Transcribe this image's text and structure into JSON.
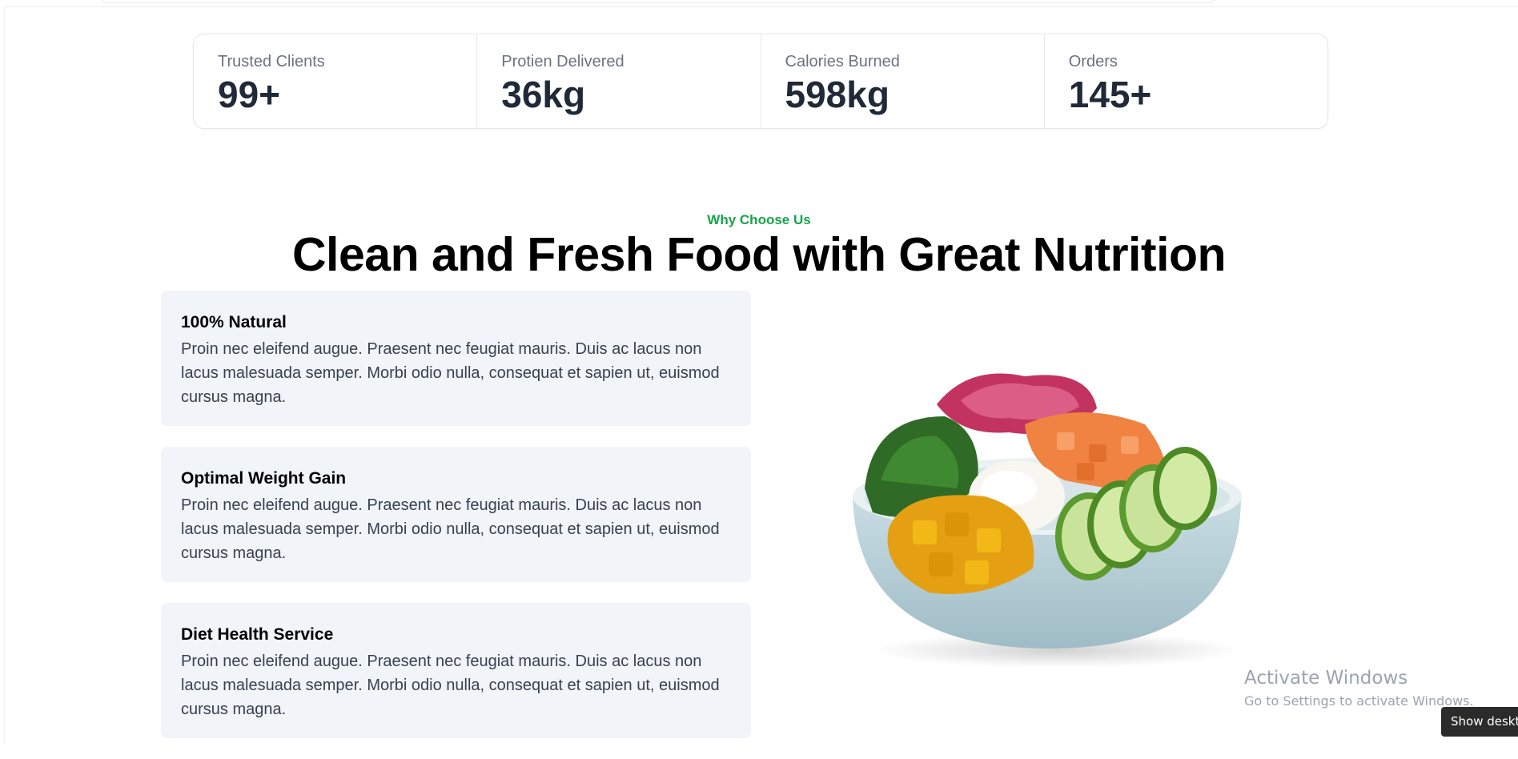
{
  "stats": [
    {
      "label": "Trusted Clients",
      "value": "99+"
    },
    {
      "label": "Protien Delivered",
      "value": "36kg"
    },
    {
      "label": "Calories Burned",
      "value": "598kg"
    },
    {
      "label": "Orders",
      "value": "145+"
    }
  ],
  "section": {
    "eyebrow": "Why Choose Us",
    "title": "Clean and Fresh Food with Great Nutrition"
  },
  "features": [
    {
      "title": "100% Natural",
      "body": "Proin nec eleifend augue. Praesent nec feugiat mauris. Duis ac lacus non lacus malesuada semper. Morbi odio nulla, consequat et sapien ut, euismod cursus magna."
    },
    {
      "title": "Optimal Weight Gain",
      "body": "Proin nec eleifend augue. Praesent nec feugiat mauris. Duis ac lacus non lacus malesuada semper. Morbi odio nulla, consequat et sapien ut, euismod cursus magna."
    },
    {
      "title": "Diet Health Service",
      "body": "Proin nec eleifend augue. Praesent nec feugiat mauris. Duis ac lacus non lacus malesuada semper. Morbi odio nulla, consequat et sapien ut, euismod cursus magna."
    }
  ],
  "image": {
    "icon": "poke-bowl-image"
  },
  "os_overlay": {
    "activate_title": "Activate Windows",
    "activate_sub": "Go to Settings to activate Windows.",
    "show_desktop": "Show desktop"
  },
  "colors": {
    "accent": "#16a34a",
    "card_bg": "#f1f4f8",
    "heading": "#000000",
    "stat_value": "#1f2937"
  }
}
